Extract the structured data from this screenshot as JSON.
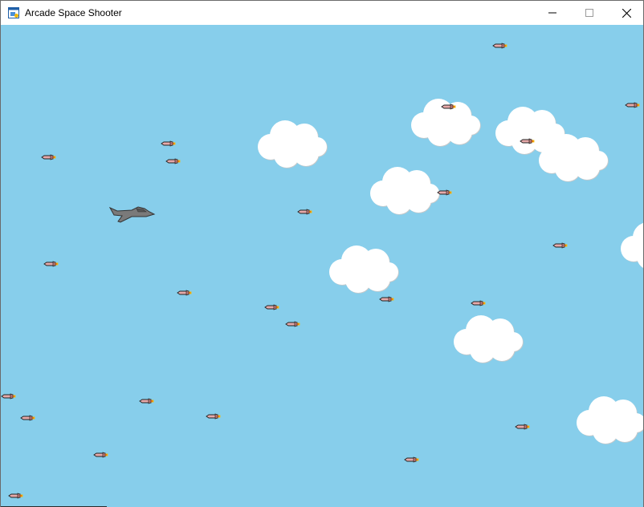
{
  "window": {
    "title": "Arcade Space Shooter",
    "app_icon": "window-app-icon",
    "controls": [
      "minimize-icon",
      "maximize-icon",
      "close-icon"
    ]
  },
  "game": {
    "background_color": "#87ceeb",
    "cloud_color": "#ffffff",
    "missile_body_color": "#e7a9a9",
    "missile_flame_color": "#f2b705",
    "player_color": "#7a7a7a",
    "player": {
      "sprite": "jet-icon",
      "direction": "right"
    },
    "cloud_count": 8,
    "missile_count": 27,
    "missile_direction": "left"
  }
}
